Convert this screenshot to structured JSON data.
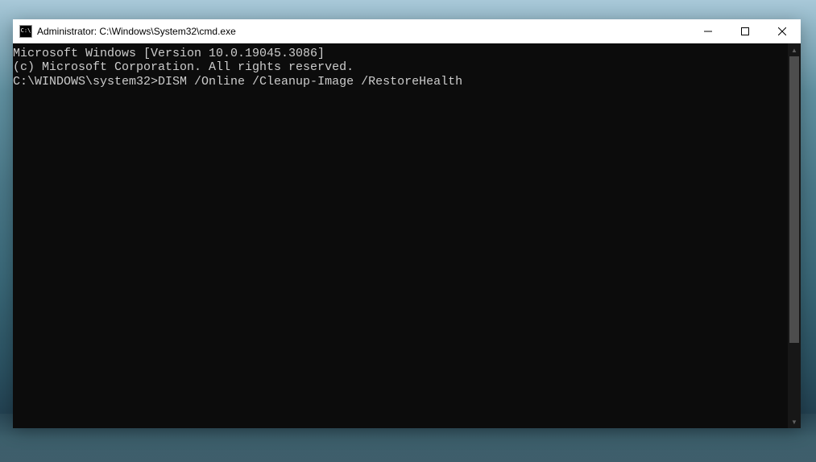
{
  "window": {
    "title": "Administrator: C:\\Windows\\System32\\cmd.exe",
    "icon_text": "C:\\"
  },
  "terminal": {
    "line1": "Microsoft Windows [Version 10.0.19045.3086]",
    "line2": "(c) Microsoft Corporation. All rights reserved.",
    "line3": "",
    "prompt": "C:\\WINDOWS\\system32>",
    "command": "DISM /Online /Cleanup-Image /RestoreHealth"
  }
}
